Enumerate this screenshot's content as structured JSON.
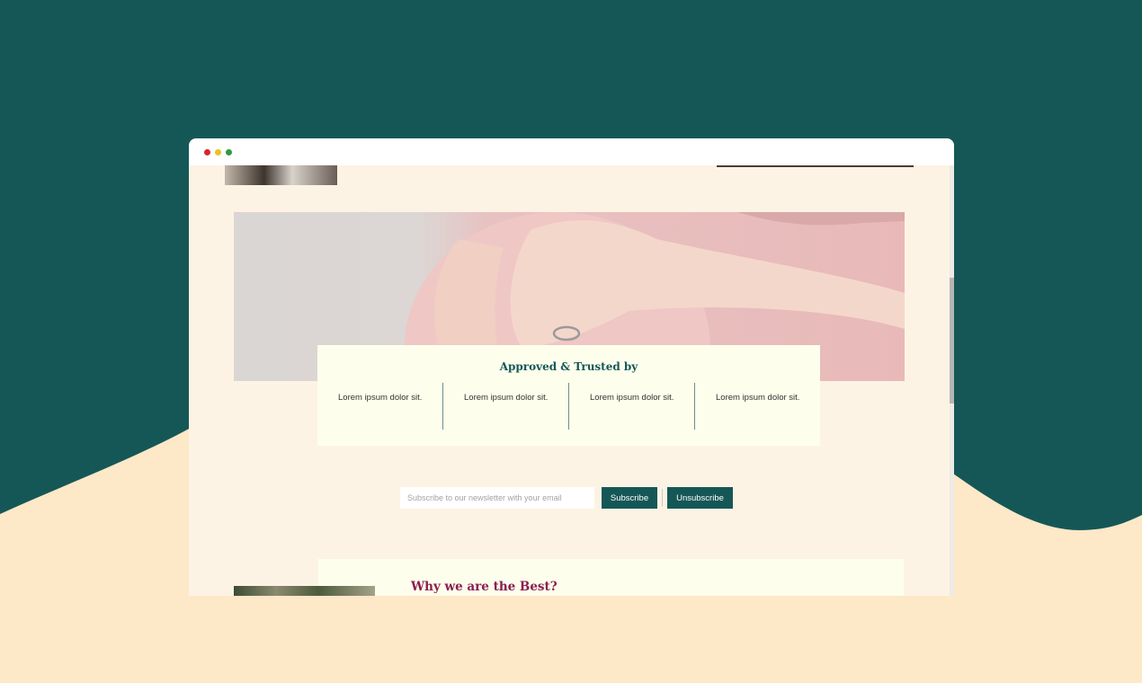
{
  "browser": {
    "window_controls": [
      "close",
      "minimize",
      "maximize"
    ]
  },
  "hero": {
    "image": "pregnant-belly-heart-hands"
  },
  "trusted": {
    "title": "Approved & Trusted by",
    "items": [
      "Lorem ipsum dolor sit.",
      "Lorem ipsum dolor sit.",
      "Lorem ipsum dolor sit.",
      "Lorem ipsum dolor sit."
    ]
  },
  "newsletter": {
    "placeholder": "Subscribe to our newsletter with your email",
    "subscribe_label": "Subscribe",
    "unsubscribe_label": "Unsubscribe"
  },
  "best": {
    "title": "Why we are the Best?"
  },
  "colors": {
    "brand_green": "#155757",
    "cream": "#fdf3e4",
    "card": "#fefeec",
    "accent_maroon": "#8a1e4f"
  }
}
